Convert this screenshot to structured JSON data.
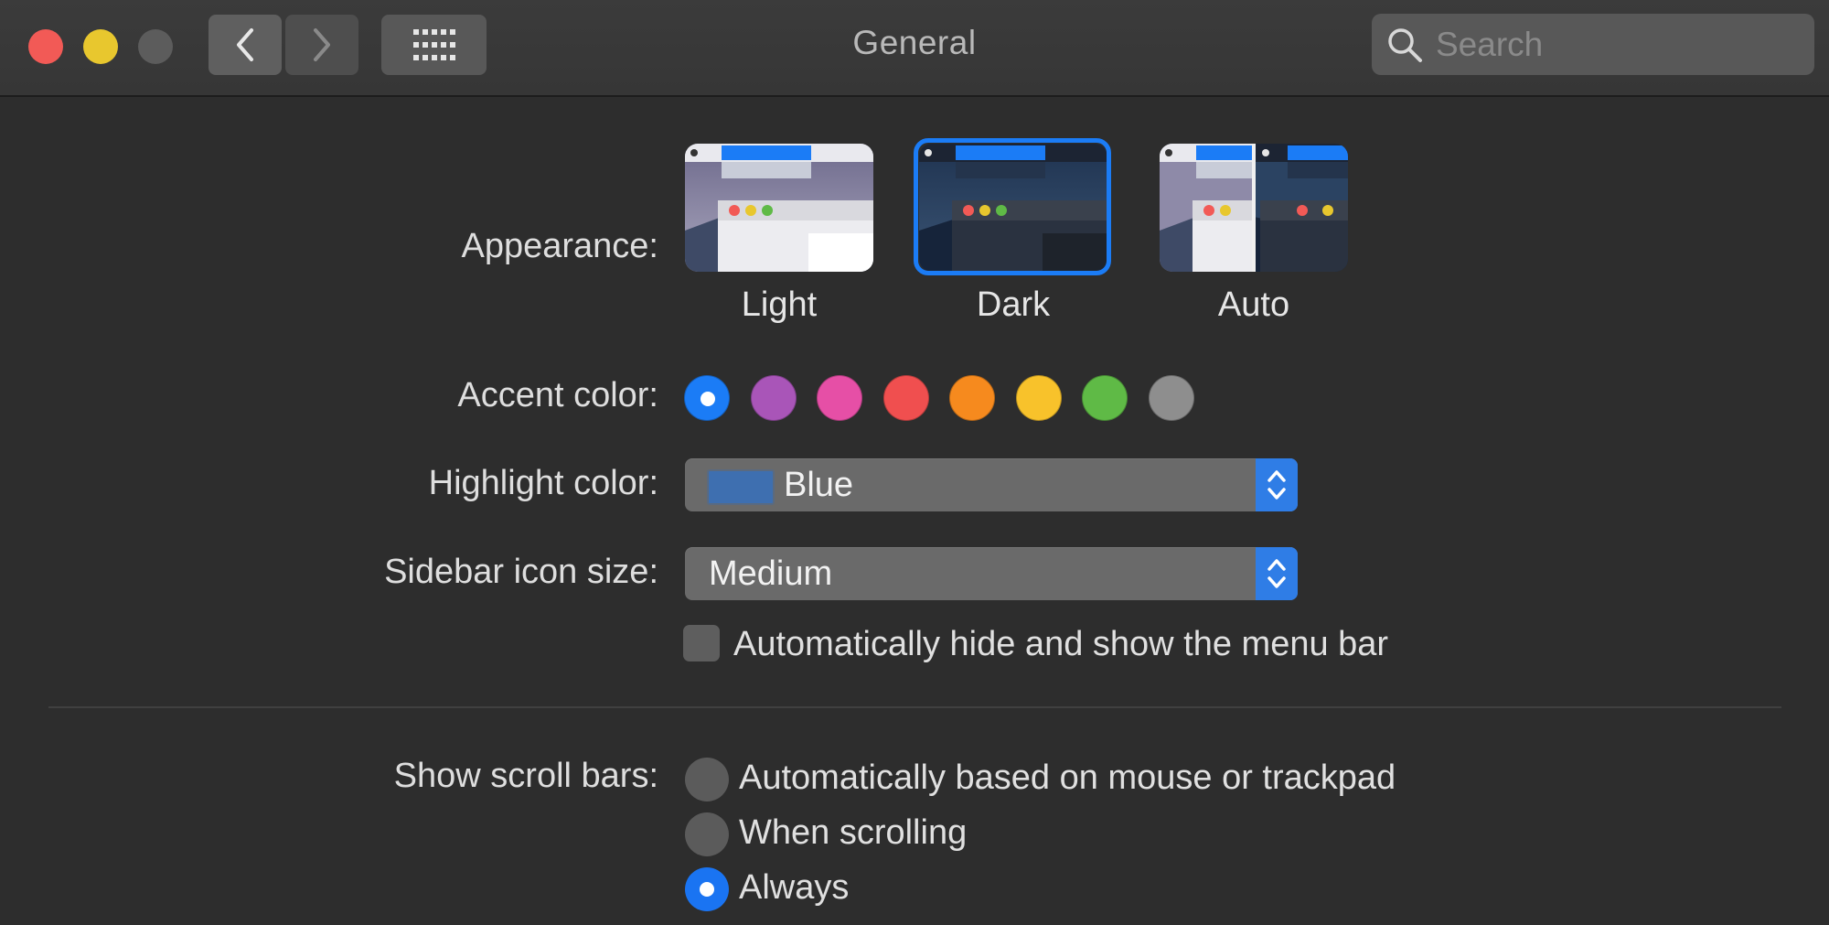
{
  "window": {
    "title": "General",
    "search_placeholder": "Search"
  },
  "appearance": {
    "label": "Appearance:",
    "options": [
      {
        "label": "Light",
        "selected": false
      },
      {
        "label": "Dark",
        "selected": true
      },
      {
        "label": "Auto",
        "selected": false
      }
    ]
  },
  "accent": {
    "label": "Accent color:",
    "selected": "#1b7cf6",
    "colors": [
      "#1b7cf6",
      "#a955b8",
      "#e64fa6",
      "#f04f4f",
      "#f68a1e",
      "#f8c22b",
      "#5fba46",
      "#8e8e8e"
    ]
  },
  "highlight": {
    "label": "Highlight color:",
    "value": "Blue"
  },
  "sidebar_icon_size": {
    "label": "Sidebar icon size:",
    "value": "Medium"
  },
  "menubar": {
    "label": "Automatically hide and show the menu bar",
    "checked": false
  },
  "scroll_bars": {
    "label": "Show scroll bars:",
    "options": [
      {
        "label": "Automatically based on mouse or trackpad",
        "selected": false
      },
      {
        "label": "When scrolling",
        "selected": false
      },
      {
        "label": "Always",
        "selected": true
      }
    ]
  }
}
